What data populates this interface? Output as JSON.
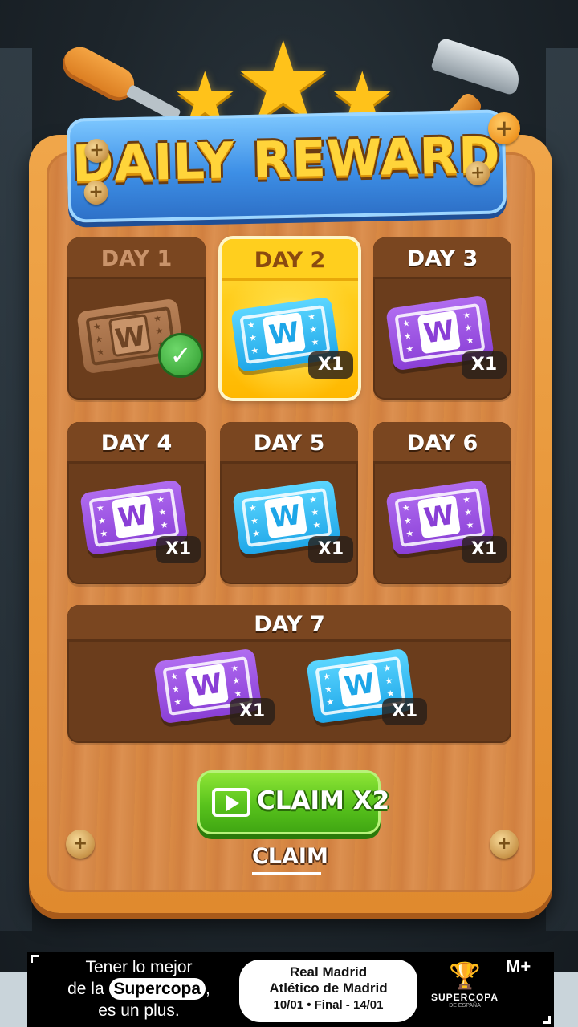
{
  "title": "DAILY REWARD",
  "days": [
    {
      "label": "DAY 1",
      "state": "claimed",
      "tickets": [
        {
          "color": "brown",
          "letter": "W"
        }
      ]
    },
    {
      "label": "DAY 2",
      "state": "current",
      "tickets": [
        {
          "color": "blue",
          "letter": "W",
          "qty": "X1"
        }
      ]
    },
    {
      "label": "DAY 3",
      "state": "locked",
      "tickets": [
        {
          "color": "purple",
          "letter": "W",
          "qty": "X1"
        }
      ]
    },
    {
      "label": "DAY 4",
      "state": "locked",
      "tickets": [
        {
          "color": "purple",
          "letter": "W",
          "qty": "X1"
        }
      ]
    },
    {
      "label": "DAY 5",
      "state": "locked",
      "tickets": [
        {
          "color": "blue",
          "letter": "W",
          "qty": "X1"
        }
      ]
    },
    {
      "label": "DAY 6",
      "state": "locked",
      "tickets": [
        {
          "color": "purple",
          "letter": "W",
          "qty": "X1"
        }
      ]
    },
    {
      "label": "DAY 7",
      "state": "locked",
      "tickets": [
        {
          "color": "purple",
          "letter": "W",
          "qty": "X1"
        },
        {
          "color": "blue",
          "letter": "W",
          "qty": "X1"
        }
      ]
    }
  ],
  "buttons": {
    "claim_x2": "CLAIM X2",
    "claim": "CLAIM"
  },
  "ad": {
    "line1": "Tener lo mejor",
    "line2_pre": "de la",
    "line2_pill": "Supercopa",
    "line2_post": ",",
    "line3": "es un plus.",
    "match_team1": "Real Madrid",
    "match_team2": "Atlético de Madrid",
    "match_dates": "10/01  •  Final - 14/01",
    "logo_text": "SUPERCOPA",
    "logo_sub": "DE ESPAÑA",
    "brand": "M+"
  },
  "colors": {
    "ticket_purple": "#8a3fd6",
    "ticket_blue": "#1ea6e8",
    "claim_green": "#58c21c",
    "title_yellow": "#ffd43a"
  }
}
